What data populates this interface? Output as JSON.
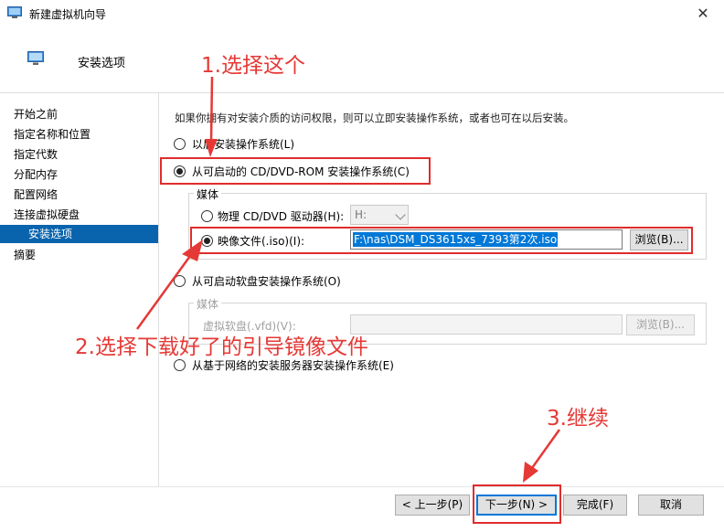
{
  "window": {
    "title": "新建虚拟机向导",
    "close": "✕"
  },
  "header": {
    "title": "安装选项"
  },
  "nav": {
    "items": [
      "开始之前",
      "指定名称和位置",
      "指定代数",
      "分配内存",
      "配置网络",
      "连接虚拟硬盘",
      "安装选项",
      "摘要"
    ],
    "active_index": 6
  },
  "content": {
    "intro": "如果你拥有对安装介质的访问权限，则可以立即安装操作系统，或者也可在以后安装。",
    "opt_later": "以后安装操作系统(L)",
    "opt_cd": "从可启动的 CD/DVD-ROM 安装操作系统(C)",
    "media_group": "媒体",
    "physical_drive": "物理 CD/DVD 驱动器(H):",
    "drive_value": "H:",
    "image_file": "映像文件(.iso)(I):",
    "image_path": "F:\\nas\\DSM_DS3615xs_7393第2次.iso",
    "browse": "浏览(B)...",
    "opt_floppy": "从可启动软盘安装操作系统(O)",
    "floppy_group": "媒体",
    "floppy_label": "虚拟软盘(.vfd)(V):",
    "floppy_value": "",
    "floppy_browse": "浏览(B)...",
    "opt_network": "从基于网络的安装服务器安装操作系统(E)"
  },
  "footer": {
    "prev": "< 上一步(P)",
    "next": "下一步(N) >",
    "finish": "完成(F)",
    "cancel": "取消"
  },
  "annotations": {
    "step1": "1.选择这个",
    "step2": "2.选择下载好了的引导镜像文件",
    "step3": "3.继续"
  },
  "colors": {
    "annotation_red": "#e02c2c",
    "selection_blue": "#0078d7",
    "nav_active": "#0a64ad"
  },
  "selected_option": "opt_cd",
  "selected_media": "image_file"
}
